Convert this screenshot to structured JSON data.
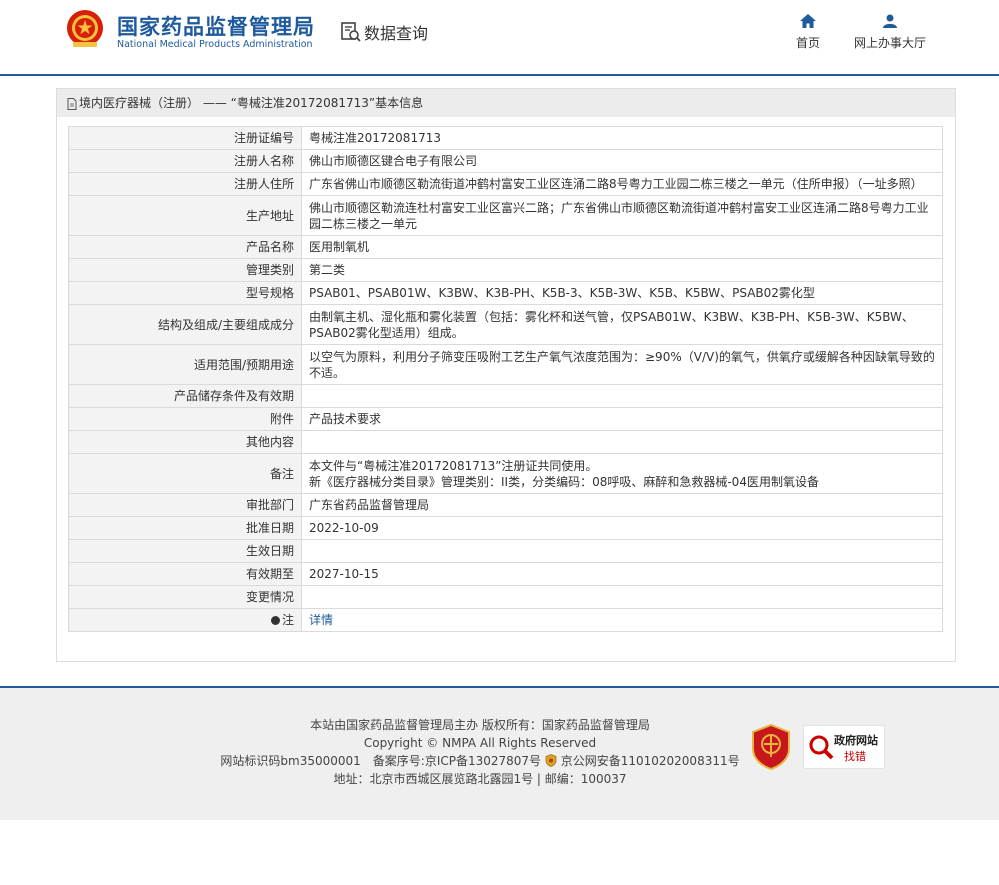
{
  "header": {
    "org_cn": "国家药品监督管理局",
    "org_en": "National Medical Products Administration",
    "query_label": "数据查询",
    "nav": [
      {
        "label": "首页",
        "icon": "home-icon"
      },
      {
        "label": "网上办事大厅",
        "icon": "user-icon"
      }
    ]
  },
  "panel": {
    "crumb_category": "境内医疗器械（注册）",
    "crumb_sep": "——",
    "crumb_title": "“粤械注准20172081713”基本信息",
    "rows": [
      {
        "label": "注册证编号",
        "value": "粤械注准20172081713"
      },
      {
        "label": "注册人名称",
        "value": "佛山市顺德区键合电子有限公司"
      },
      {
        "label": "注册人住所",
        "value": "广东省佛山市顺德区勒流街道冲鹤村富安工业区连涌二路8号粤力工业园二栋三楼之一单元（住所申报）（一址多照）"
      },
      {
        "label": "生产地址",
        "value": "佛山市顺德区勒流连杜村富安工业区富兴二路；广东省佛山市顺德区勒流街道冲鹤村富安工业区连涌二路8号粤力工业园二栋三楼之一单元"
      },
      {
        "label": "产品名称",
        "value": "医用制氧机"
      },
      {
        "label": "管理类别",
        "value": "第二类"
      },
      {
        "label": "型号规格",
        "value": "PSAB01、PSAB01W、K3BW、K3B-PH、K5B-3、K5B-3W、K5B、K5BW、PSAB02雾化型"
      },
      {
        "label": "结构及组成/主要组成成分",
        "value": "由制氧主机、湿化瓶和雾化装置（包括：雾化杯和送气管，仅PSAB01W、K3BW、K3B-PH、K5B-3W、K5BW、PSAB02雾化型适用）组成。"
      },
      {
        "label": "适用范围/预期用途",
        "value": "以空气为原料，利用分子筛变压吸附工艺生产氧气浓度范围为：≥90%（V/V)的氧气，供氧疗或缓解各种因缺氧导致的不适。"
      },
      {
        "label": "产品储存条件及有效期",
        "value": ""
      },
      {
        "label": "附件",
        "value": "产品技术要求"
      },
      {
        "label": "其他内容",
        "value": ""
      },
      {
        "label": "备注",
        "value": "本文件与“粤械注准20172081713”注册证共同使用。",
        "value2": "新《医疗器械分类目录》管理类别：II类，分类编码：08呼吸、麻醉和急救器械-04医用制氧设备"
      },
      {
        "label": "审批部门",
        "value": "广东省药品监督管理局"
      },
      {
        "label": "批准日期",
        "value": "2022-10-09"
      },
      {
        "label": "生效日期",
        "value": ""
      },
      {
        "label": "有效期至",
        "value": "2027-10-15"
      },
      {
        "label": "变更情况",
        "value": ""
      },
      {
        "label": "注",
        "value": "详情"
      }
    ]
  },
  "footer": {
    "line1": "本站由国家药品监督管理局主办 版权所有：国家药品监督管理局",
    "line2": "Copyright © NMPA All Rights Reserved",
    "line3_a": "网站标识码bm35000001　备案序号:京ICP备13027807号",
    "line3_b": "京公网安备11010202008311号",
    "line4": "地址：北京市西城区展览路北露园1号 | 邮编：100037",
    "badge_red_text": "党政机关",
    "badge_gov_t1": "政府网站",
    "badge_gov_t2": "找错"
  },
  "colors": {
    "brand": "#1e5a9c",
    "label_bg": "#f3f3f3",
    "footer_bg": "#efefef"
  }
}
